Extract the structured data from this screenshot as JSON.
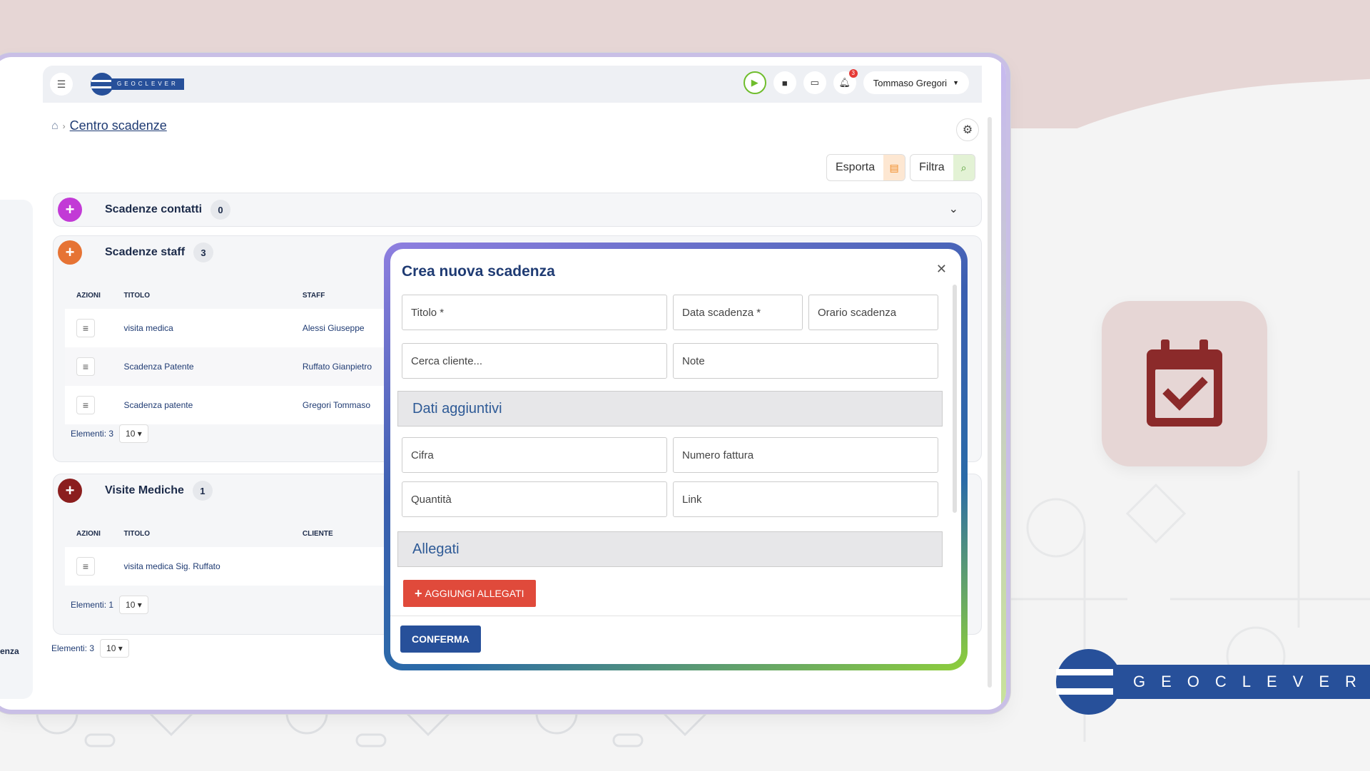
{
  "topbar": {
    "logo_text": "GEOCLEVER",
    "notification_count": "3",
    "user_name": "Tommaso Gregori"
  },
  "breadcrumb": {
    "current": "Centro scadenze"
  },
  "actions": {
    "export_label": "Esporta",
    "filter_label": "Filtra"
  },
  "sections": [
    {
      "title": "Scadenze contatti",
      "count": "0",
      "color": "#c23ad6"
    },
    {
      "title": "Scadenze staff",
      "count": "3",
      "color": "#e67334",
      "columns": [
        "AZIONI",
        "TITOLO",
        "STAFF"
      ],
      "rows": [
        {
          "title": "visita medica",
          "person": "Alessi Giuseppe"
        },
        {
          "title": "Scadenza Patente",
          "person": "Ruffato Gianpietro"
        },
        {
          "title": "Scadenza patente",
          "person": "Gregori Tommaso"
        }
      ],
      "footer_label": "Elementi: 3",
      "page_size": "10"
    },
    {
      "title": "Visite Mediche",
      "count": "1",
      "color": "#8b1e1e",
      "columns": [
        "AZIONI",
        "TITOLO",
        "CLIENTE"
      ],
      "rows": [
        {
          "title": "visita medica Sig. Ruffato",
          "person": ""
        }
      ],
      "footer_label": "Elementi: 1",
      "page_size": "10"
    }
  ],
  "outer_footer": {
    "label": "Elementi: 3",
    "page_size": "10"
  },
  "left_rail_text": "enza",
  "modal": {
    "title": "Crea nuova scadenza",
    "fields": {
      "titolo": "Titolo *",
      "data_scadenza": "Data scadenza *",
      "orario_scadenza": "Orario scadenza",
      "cerca_cliente": "Cerca cliente...",
      "note": "Note",
      "cifra": "Cifra",
      "numero_fattura": "Numero fattura",
      "quantita": "Quantità",
      "link": "Link"
    },
    "band_dati": "Dati aggiuntivi",
    "band_allegati": "Allegati",
    "add_attachments_label": "AGGIUNGI ALLEGATI",
    "confirm_label": "CONFERMA"
  },
  "brand": {
    "logo_text": "GEOCLEVER",
    "primary_color": "#27509a",
    "accent_color": "#e6d6d5"
  },
  "icons": [
    "menu-icon",
    "play-icon",
    "chat-icon",
    "monitor-icon",
    "bell-icon",
    "chevron-down-icon",
    "home-icon",
    "gear-icon",
    "pdf-icon",
    "search-icon",
    "plus-icon",
    "list-icon",
    "close-icon",
    "calendar-check-icon"
  ]
}
